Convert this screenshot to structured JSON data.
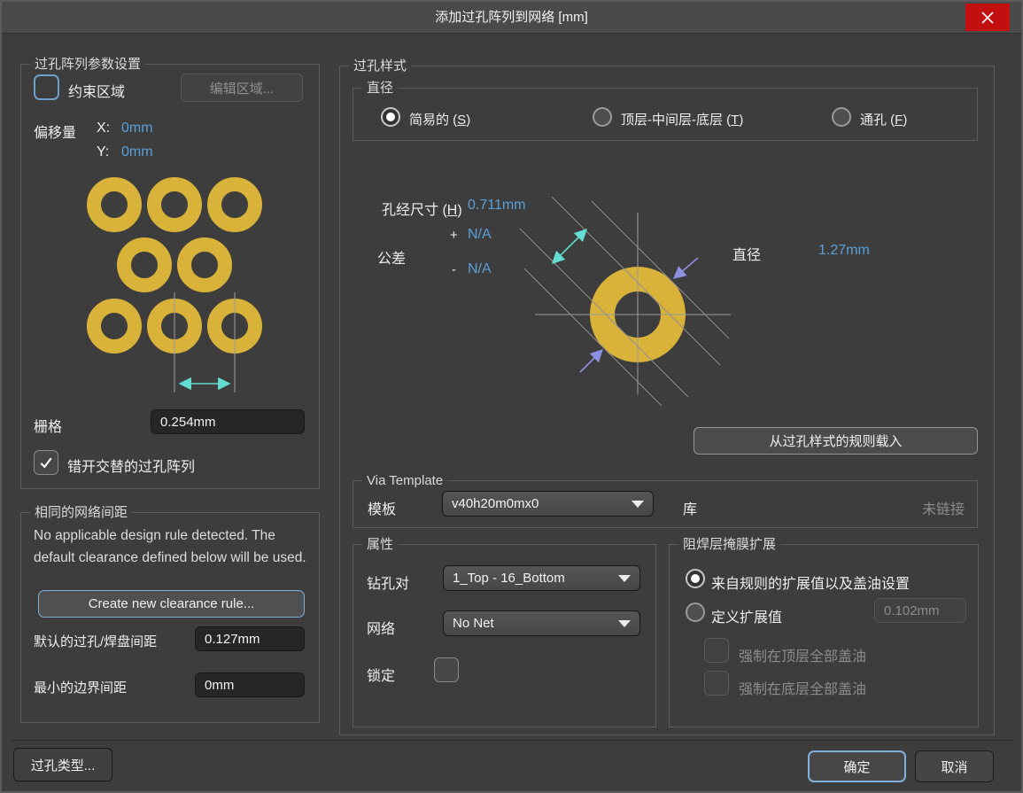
{
  "window": {
    "title": "添加过孔阵列到网络 [mm]"
  },
  "array_settings": {
    "group_title": "过孔阵列参数设置",
    "constrain_area_label": "约束区域",
    "constrain_area_checked": false,
    "edit_area_button": "编辑区域...",
    "offset_label": "偏移量",
    "offset_x_label": "X:",
    "offset_x_value": "0mm",
    "offset_y_label": "Y:",
    "offset_y_value": "0mm",
    "grid_label": "栅格",
    "grid_value": "0.254mm",
    "stagger_checkbox_label": "错开交替的过孔阵列",
    "stagger_checked": true
  },
  "same_net_clearance": {
    "group_title": "相同的网络间距",
    "message": "No applicable design rule detected. The default clearance defined below will be used.",
    "create_rule_button": "Create new clearance rule...",
    "default_clearance_label": "默认的过孔/焊盘间距",
    "default_clearance_value": "0.127mm",
    "min_boundary_label": "最小的边界间距",
    "min_boundary_value": "0mm"
  },
  "via_style": {
    "group_title": "过孔样式",
    "diameter_mode": {
      "group_title": "直径",
      "options": [
        {
          "pre": "简易的 (",
          "hotkey": "S",
          "post": ")",
          "selected": true
        },
        {
          "pre": "顶层-中间层-底层 (",
          "hotkey": "T",
          "post": ")",
          "selected": false
        },
        {
          "pre": "通孔 (",
          "hotkey": "F",
          "post": ")",
          "selected": false
        }
      ]
    },
    "hole_size": {
      "label_pre": "孔经尺寸 (",
      "hotkey": "H",
      "label_post": ")",
      "value": "0.711mm"
    },
    "tolerance": {
      "label": "公差",
      "plus_sign": "+",
      "plus_value": "N/A",
      "minus_sign": "-",
      "minus_value": "N/A"
    },
    "diameter_label": "直径",
    "diameter_value": "1.27mm",
    "load_from_rules_button": "从过孔样式的规则载入",
    "via_template": {
      "group_title": "Via Template",
      "template_label": "模板",
      "template_value": "v40h20m0mx0",
      "library_label": "库",
      "library_status": "未链接"
    },
    "properties": {
      "group_title": "属性",
      "drill_pair_label": "钻孔对",
      "drill_pair_value": "1_Top - 16_Bottom",
      "net_label": "网络",
      "net_value": "No Net",
      "locked_label": "锁定",
      "locked_checked": false
    },
    "solder_mask": {
      "group_title": "阻焊层掩膜扩展",
      "from_rule_option": "来自规则的扩展值以及盖油设置",
      "from_rule_selected": true,
      "define_option": "定义扩展值",
      "define_selected": false,
      "expansion_value": "0.102mm",
      "force_top_label": "强制在顶层全部盖油",
      "force_bottom_label": "强制在底层全部盖油"
    }
  },
  "footer": {
    "via_types_button": "过孔类型...",
    "ok_button": "确定",
    "cancel_button": "取消"
  },
  "colors": {
    "accent_blue_text": "#5b9fd8",
    "via_pad_yellow": "#d9b23a",
    "close_button_red": "#c21010",
    "measure_cyan": "#63dcd2",
    "pointer_purple": "#8d90e0",
    "focus_border_blue": "#7fb0dc"
  }
}
